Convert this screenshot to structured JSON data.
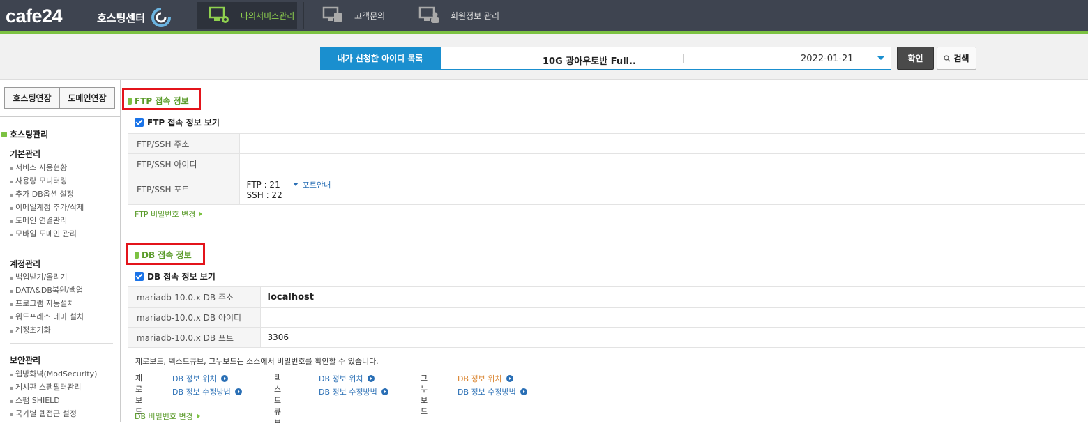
{
  "header": {
    "logo": "cafe24",
    "logo_sub": "호스팅센터",
    "nav": [
      {
        "label": "나의서비스관리",
        "icon": "monitor-gear-icon",
        "active": true
      },
      {
        "label": "고객문의",
        "icon": "monitor-phone-icon",
        "active": false
      },
      {
        "label": "회원정보 관리",
        "icon": "monitor-user-icon",
        "active": false
      }
    ]
  },
  "search_bar": {
    "id_list_label": "내가 신청한 아이디 목록",
    "plan": "10G 광아우토반 Full..",
    "date": "2022-01-21",
    "confirm_label": "확인",
    "search_label": "검색"
  },
  "sidebar": {
    "buttons": [
      "호스팅연장",
      "도메인연장"
    ],
    "title": "호스팅관리",
    "groups": [
      {
        "title": "기본관리",
        "items": [
          "서비스 사용현황",
          "사용량 모니터링",
          "추가 DB옵션 설정",
          "이메일계정 추가/삭제",
          "도메인 연결관리",
          "모바일 도메인 관리"
        ]
      },
      {
        "title": "계정관리",
        "items": [
          "백업받기/올리기",
          "DATA&DB복원/백업",
          "프로그램 자동설치",
          "워드프레스 테마 설치",
          "계정초기화"
        ]
      },
      {
        "title": "보안관리",
        "items": [
          "웹방화벽(ModSecurity)",
          "게시판 스팸필터관리",
          "스팸 SHIELD",
          "국가별 웹접근 설정"
        ]
      }
    ]
  },
  "ftp": {
    "title": "FTP 접속 정보",
    "checkbox_label": "FTP 접속 정보 보기",
    "rows": [
      {
        "label": "FTP/SSH 주소",
        "value": ""
      },
      {
        "label": "FTP/SSH 아이디",
        "value": ""
      },
      {
        "label": "FTP/SSH 포트"
      }
    ],
    "ftp_port": "FTP : 21",
    "ssh_port": "SSH : 22",
    "port_guide": "포트안내",
    "password_link": "FTP 비밀번호 변경"
  },
  "db": {
    "title": "DB 접속 정보",
    "checkbox_label": "DB 접속 정보 보기",
    "rows": [
      {
        "label": "mariadb-10.0.x DB 주소",
        "value": "localhost"
      },
      {
        "label": "mariadb-10.0.x DB 아이디",
        "value": ""
      },
      {
        "label": "mariadb-10.0.x DB 포트",
        "value": "3306"
      }
    ],
    "note": "제로보드, 텍스트큐브, 그누보드는 소스에서 비밀번호를 확인할 수 있습니다.",
    "boards": [
      {
        "name": "제로보드",
        "link1": "DB 정보 위치",
        "link2": "DB 정보 수정방법"
      },
      {
        "name": "텍스트큐브",
        "link1": "DB 정보 위치",
        "link2": "DB 정보 수정방법"
      },
      {
        "name": "그누보드",
        "link1": "DB 정보 위치",
        "link2": "DB 정보 수정방법"
      }
    ],
    "password_link": "DB 비밀번호 변경"
  },
  "colors": {
    "header_bg": "#3e4450",
    "accent_green": "#7cc242",
    "accent_blue": "#1a8fcf",
    "highlight_red": "#e3141b"
  }
}
